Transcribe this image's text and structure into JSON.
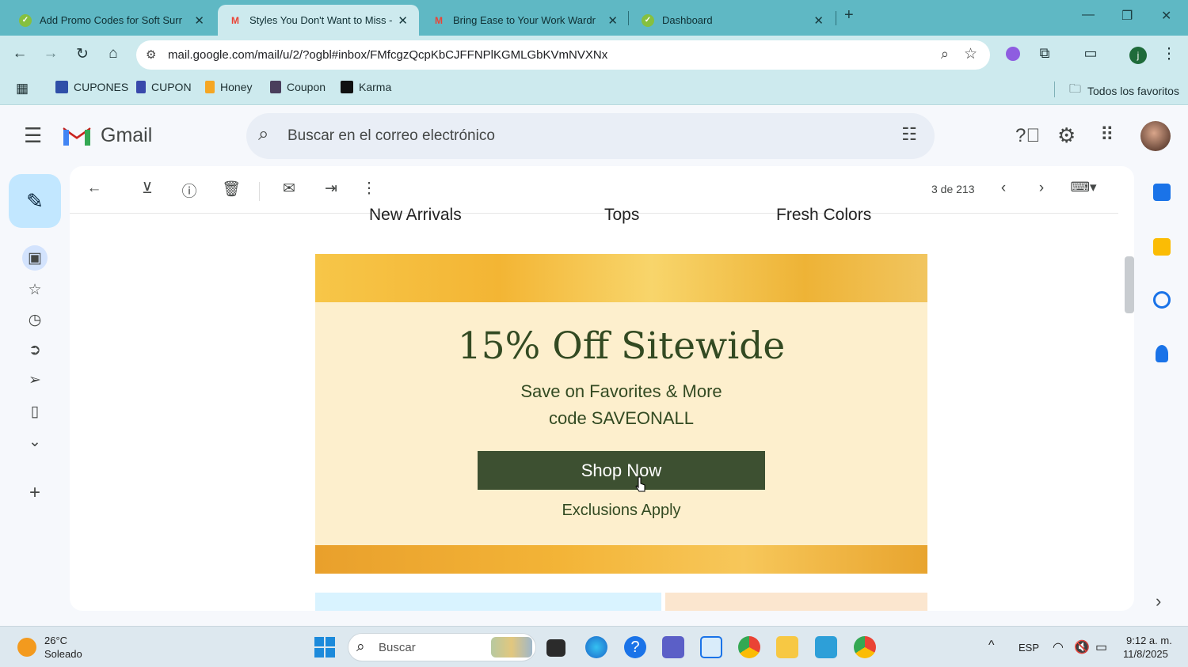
{
  "browser": {
    "tabs": [
      {
        "title": "Add Promo Codes for Soft Surr",
        "active": false
      },
      {
        "title": "Styles You Don't Want to Miss -",
        "active": true
      },
      {
        "title": "Bring Ease to Your Work Wardr",
        "active": false
      },
      {
        "title": "Dashboard",
        "active": false
      }
    ],
    "new_tab_label": "+",
    "url": "mail.google.com/mail/u/2/?ogbl#inbox/FMfcgzQcpKbCJFFNPlKGMLGbKVmNVXNx",
    "profile_initial": "j",
    "bookmarks": [
      "CUPONES",
      "CUPON",
      "Honey",
      "Coupon",
      "Karma"
    ],
    "all_bookmarks_label": "Todos los favoritos"
  },
  "gmail": {
    "logo_text": "Gmail",
    "search_placeholder": "Buscar en el correo electrónico",
    "pager_text": "3 de 213"
  },
  "email": {
    "categories": [
      "New Arrivals",
      "Tops",
      "Fresh Colors"
    ],
    "headline": "15% Off Sitewide",
    "subline1": "Save on Favorites & More",
    "subline2": "code SAVEONALL",
    "cta_label": "Shop Now",
    "note": "Exclusions Apply"
  },
  "taskbar": {
    "weather_temp": "26°C",
    "weather_desc": "Soleado",
    "search_placeholder": "Buscar",
    "language": "ESP",
    "time": "9:12 a. m.",
    "date": "11/8/2025"
  },
  "colors": {
    "tabbar": "#5fb8c4",
    "toolbar": "#cdeaee",
    "promo_bg": "#fdefcd",
    "promo_text": "#334a22",
    "cta_bg": "#3d5031",
    "compose_bg": "#c2e7ff"
  }
}
